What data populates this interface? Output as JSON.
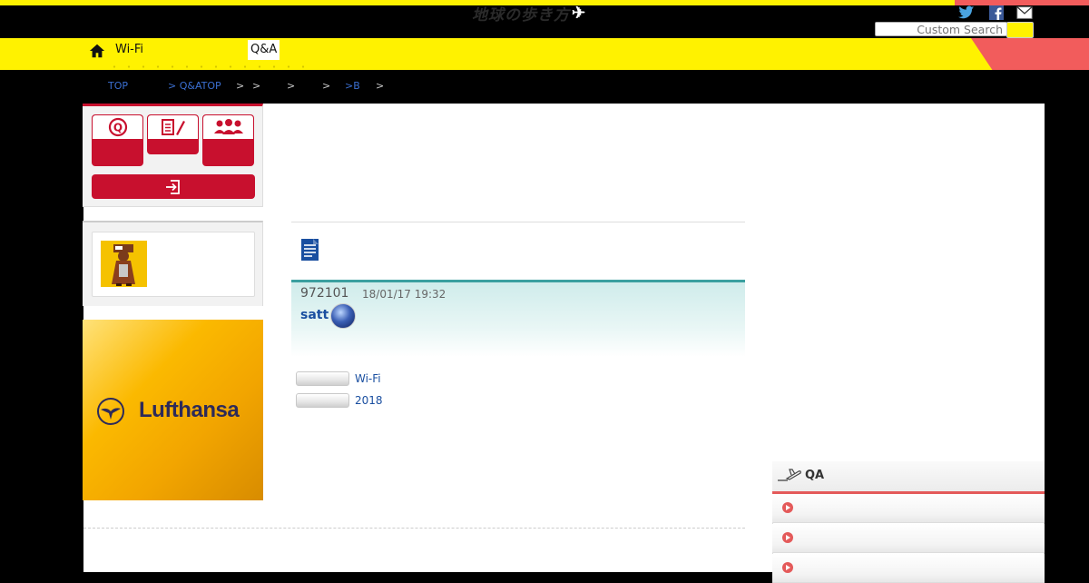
{
  "header": {
    "logo_text": "地球の歩き方",
    "logo_symbol": "✈",
    "search_placeholder": "Custom Search",
    "social": [
      "twitter-icon",
      "facebook-icon",
      "mail-icon"
    ]
  },
  "nav": {
    "items": [
      {
        "label": "Wi-Fi"
      },
      {
        "label": "Q&A"
      }
    ]
  },
  "breadcrumb": {
    "items": [
      "TOP",
      "> Q&ATOP",
      ">",
      ">",
      ">",
      ">",
      ">B",
      ">"
    ]
  },
  "sidebar": {
    "ad_brand": "Lufthansa"
  },
  "post": {
    "id": "972101",
    "date": "18/01/17 19:32",
    "user": "satt",
    "tags": [
      "Wi-Fi",
      "2018"
    ]
  },
  "qa_panel": {
    "title": "QA"
  },
  "colors": {
    "accent_yellow": "#fff200",
    "accent_red": "#c8102e",
    "panel_red": "#e45a5a",
    "teal": "#3aa0a0",
    "link_blue": "#1a4fa0"
  }
}
